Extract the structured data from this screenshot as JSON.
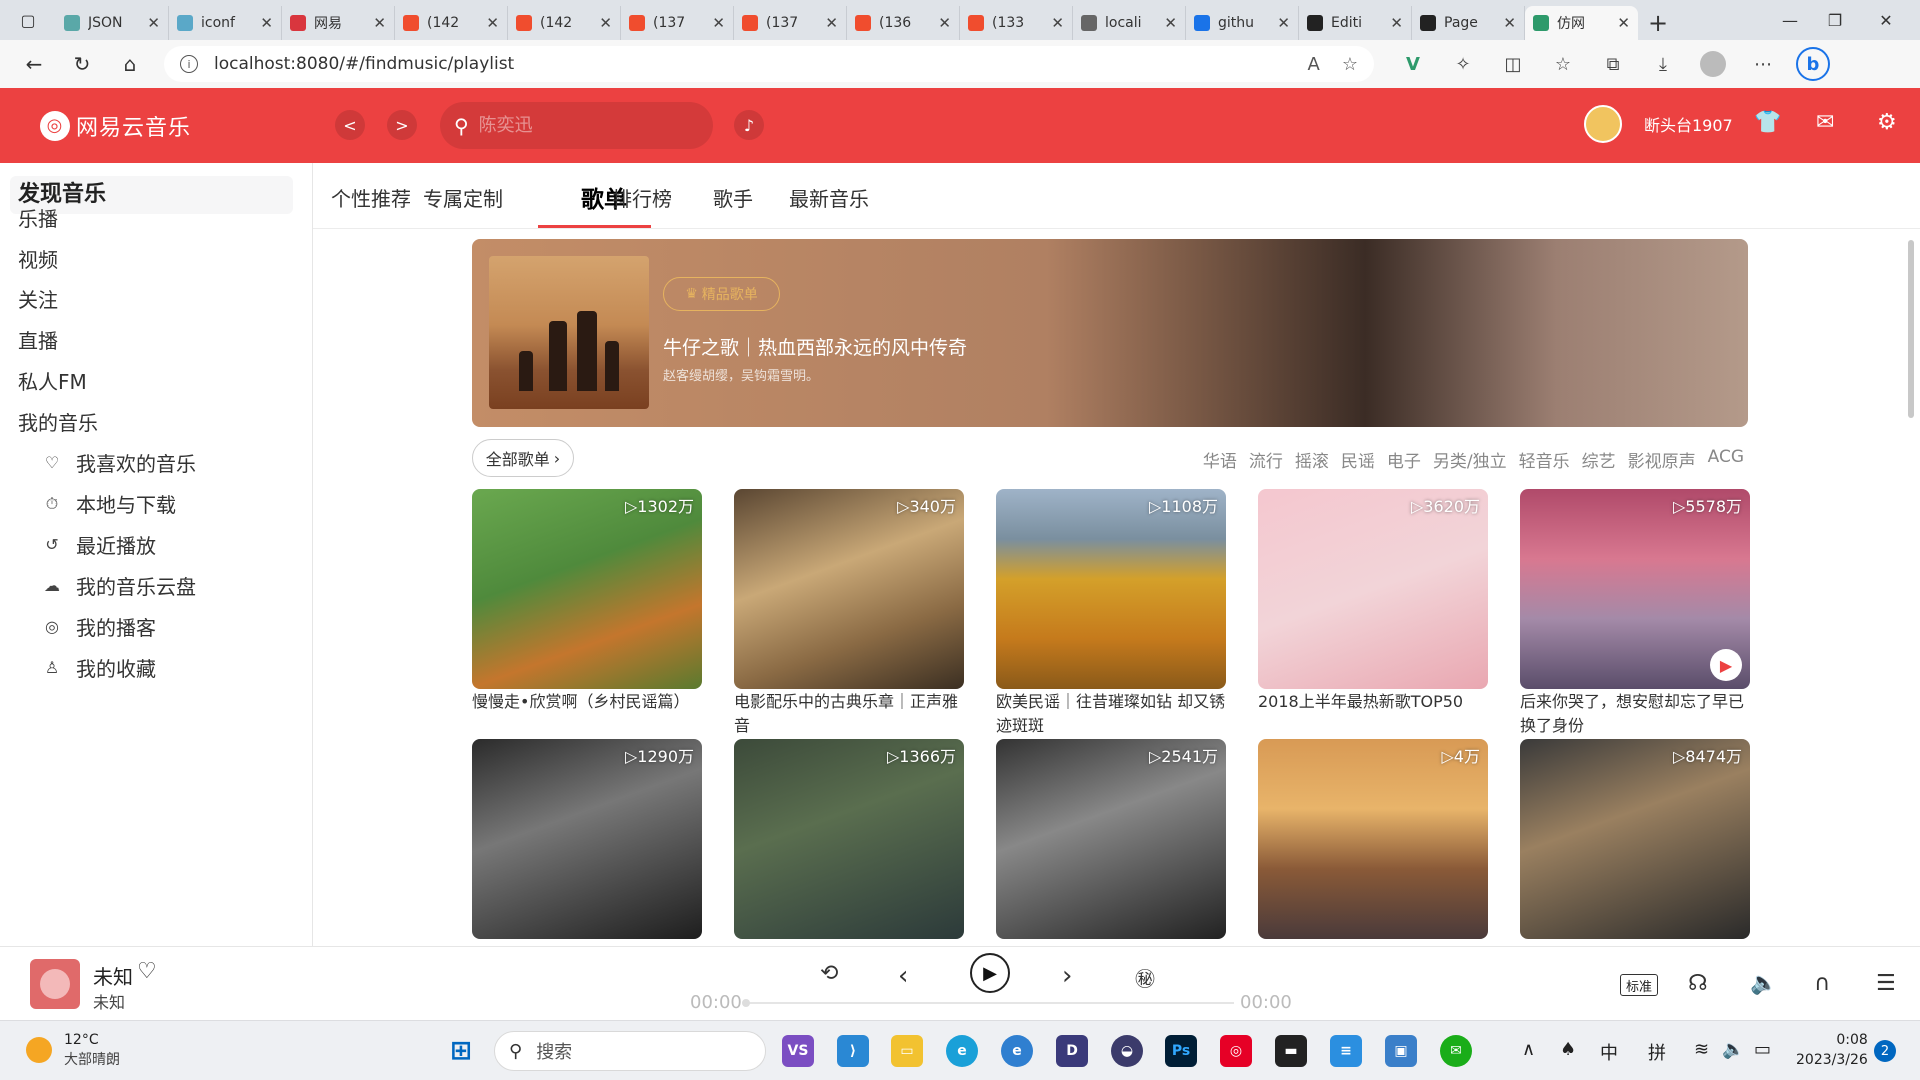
{
  "browser": {
    "tabs": [
      {
        "label": "JSON",
        "color": "#5aa8a8"
      },
      {
        "label": "iconf",
        "color": "#5aa8c8"
      },
      {
        "label": "网易",
        "color": "#d9363e"
      },
      {
        "label": "(142",
        "color": "#f04d2e"
      },
      {
        "label": "(142",
        "color": "#f04d2e"
      },
      {
        "label": "(137",
        "color": "#f04d2e"
      },
      {
        "label": "(137",
        "color": "#f04d2e"
      },
      {
        "label": "(136",
        "color": "#f04d2e"
      },
      {
        "label": "(133",
        "color": "#f04d2e"
      },
      {
        "label": "locali",
        "color": "#666666"
      },
      {
        "label": "githu",
        "color": "#1a73e8"
      },
      {
        "label": "Editi",
        "color": "#222222"
      },
      {
        "label": "Page",
        "color": "#222222"
      },
      {
        "label": "仿网",
        "color": "#2e9a6b"
      }
    ],
    "url": "localhost:8080/#/findmusic/playlist"
  },
  "app": {
    "logo_text": "网易云音乐",
    "search_placeholder": "陈奕迅",
    "username": "断头台1907",
    "accent": "#ec4141"
  },
  "sidebar": {
    "active": "发现音乐",
    "items": [
      "乐播",
      "视频",
      "关注",
      "直播",
      "私人FM",
      "我的音乐"
    ],
    "sub_items": [
      {
        "label": "我喜欢的音乐",
        "icon": "heart-icon"
      },
      {
        "label": "本地与下载",
        "icon": "download-icon"
      },
      {
        "label": "最近播放",
        "icon": "history-icon"
      },
      {
        "label": "我的音乐云盘",
        "icon": "cloud-icon"
      },
      {
        "label": "我的播客",
        "icon": "podcast-icon"
      },
      {
        "label": "我的收藏",
        "icon": "user-icon"
      }
    ]
  },
  "subnav": {
    "tabs": [
      "个性推荐",
      "专属定制",
      "歌单",
      "排行榜",
      "歌手",
      "最新音乐"
    ],
    "active_index": 2
  },
  "banner": {
    "tag": "精品歌单",
    "title": "牛仔之歌｜热血西部永远的风中传奇",
    "desc": "赵客缦胡缨，吴钩霜雪明。"
  },
  "filters": {
    "all_label": "全部歌单",
    "categories": [
      "华语",
      "流行",
      "摇滚",
      "民谣",
      "电子",
      "另类/独立",
      "轻音乐",
      "综艺",
      "影视原声",
      "ACG"
    ]
  },
  "playlists": [
    {
      "name": "慢慢走•欣赏啊（乡村民谣篇）",
      "plays": "▷1302万"
    },
    {
      "name": "电影配乐中的古典乐章｜正声雅音",
      "plays": "▷340万"
    },
    {
      "name": "欧美民谣｜往昔璀璨如钻 却又锈迹斑斑",
      "plays": "▷1108万"
    },
    {
      "name": "2018上半年最热新歌TOP50",
      "plays": "▷3620万"
    },
    {
      "name": "后来你哭了，想安慰却忘了早已换了身份",
      "plays": "▷5578万"
    },
    {
      "name": "",
      "plays": "▷1290万"
    },
    {
      "name": "",
      "plays": "▷1366万"
    },
    {
      "name": "",
      "plays": "▷2541万"
    },
    {
      "name": "",
      "plays": "▷4万"
    },
    {
      "name": "",
      "plays": "▷8474万"
    }
  ],
  "player": {
    "title": "未知",
    "artist": "未知",
    "time_current": "00:00",
    "time_total": "00:00",
    "quality": "标准",
    "progress": 0
  },
  "taskbar": {
    "temp": "12°C",
    "weather": "大部晴朗",
    "search": "搜索",
    "ime_lang": "中",
    "ime_mode": "拼",
    "time": "0:08",
    "date": "2023/3/26",
    "notifications": "2"
  }
}
